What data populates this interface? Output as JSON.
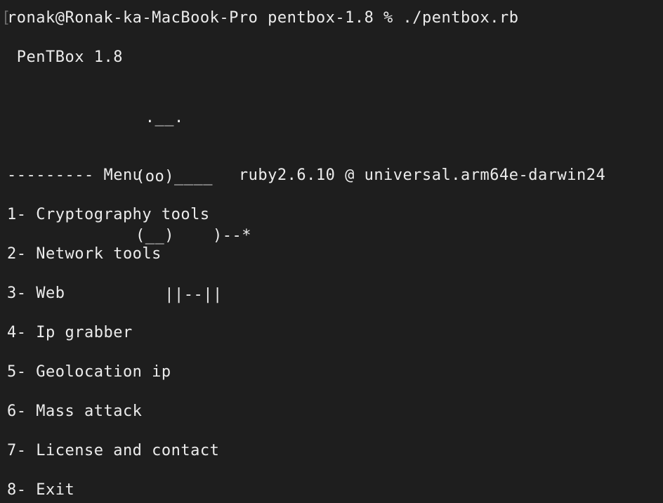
{
  "terminal": {
    "prompt_line": "ronak@Ronak-ka-MacBook-Pro pentbox-1.8 % ./pentbox.rb",
    "banner_title": " PenTBox 1.8",
    "ascii_art": [
      " .__.",
      "(oo)____",
      "(__)    )--*",
      "   ||--||"
    ],
    "menu_header": "--------- Menu          ruby2.6.10 @ universal.arm64e-darwin24",
    "menu_items": [
      "1- Cryptography tools",
      "2- Network tools",
      "3- Web",
      "4- Ip grabber",
      "5- Geolocation ip",
      "6- Mass attack",
      "7- License and contact",
      "8- Exit"
    ]
  }
}
